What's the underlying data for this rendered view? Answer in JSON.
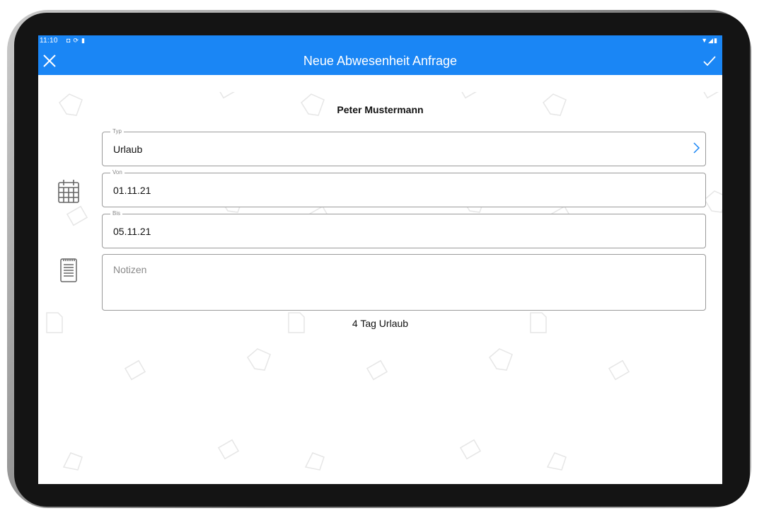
{
  "status_bar": {
    "time": "11:10",
    "left_icons": [
      "notification-icon",
      "sync-icon",
      "battery-saver-icon"
    ],
    "right_icons": [
      "wifi-icon",
      "signal-icon",
      "battery-icon"
    ]
  },
  "app_bar": {
    "title": "Neue Abwesenheit Anfrage",
    "close_icon": "close-icon",
    "confirm_icon": "check-icon",
    "color": "#1a86f5"
  },
  "employee_name": "Peter Mustermann",
  "form": {
    "typ": {
      "label": "Typ",
      "value": "Urlaub"
    },
    "von": {
      "label": "Von",
      "value": "01.11.21"
    },
    "bis": {
      "label": "Bis",
      "value": "05.11.21"
    },
    "notizen": {
      "placeholder": "Notizen",
      "value": ""
    }
  },
  "summary": "4 Tag Urlaub",
  "colors": {
    "accent": "#1a86f5",
    "field_border": "#9a9a9a",
    "pattern": "#ececec"
  }
}
